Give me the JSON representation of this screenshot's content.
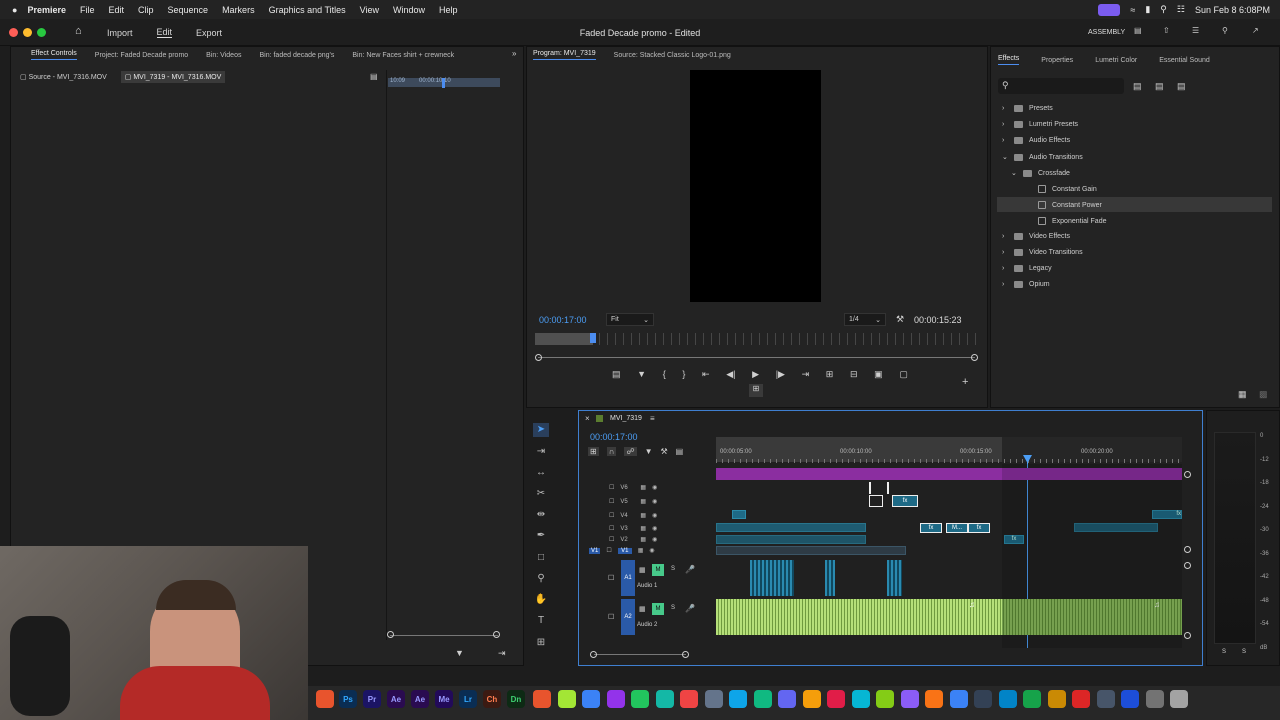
{
  "menubar": {
    "app": "Premiere",
    "items": [
      "File",
      "Edit",
      "Clip",
      "Sequence",
      "Markers",
      "Graphics and Titles",
      "View",
      "Window",
      "Help"
    ],
    "datetime": "Sun Feb 8  6:08PM"
  },
  "header": {
    "nav": [
      "Import",
      "Edit",
      "Export"
    ],
    "title": "Faded Decade promo - Edited",
    "workspace": "ASSEMBLY"
  },
  "left_panel": {
    "tabs": [
      "Effect Controls",
      "Project: Faded Decade promo",
      "Bin: Videos",
      "Bin: faded decade png's",
      "Bin: New Faces shirt + crewneck"
    ],
    "subtabs": [
      "Source - MVI_7316.MOV",
      "MVI_7319 - MVI_7316.MOV"
    ],
    "ruler_start": "10:09",
    "ruler_mid": "00:00:10:10"
  },
  "program": {
    "tabs": [
      "Program: MVI_7319",
      "Source: Stacked Classic Logo-01.png"
    ],
    "current_time": "00:00:17:00",
    "fit": "Fit",
    "resolution": "1/4",
    "duration": "00:00:15:23"
  },
  "effects": {
    "tabs": [
      "Effects",
      "Properties",
      "Lumetri Color",
      "Essential Sound"
    ],
    "tree": [
      {
        "label": "Presets",
        "level": 0,
        "type": "folder",
        "open": false
      },
      {
        "label": "Lumetri Presets",
        "level": 0,
        "type": "folder",
        "open": false
      },
      {
        "label": "Audio Effects",
        "level": 0,
        "type": "folder",
        "open": false
      },
      {
        "label": "Audio Transitions",
        "level": 0,
        "type": "folder",
        "open": true
      },
      {
        "label": "Crossfade",
        "level": 1,
        "type": "folder",
        "open": true
      },
      {
        "label": "Constant Gain",
        "level": 2,
        "type": "effect"
      },
      {
        "label": "Constant Power",
        "level": 2,
        "type": "effect",
        "selected": true
      },
      {
        "label": "Exponential Fade",
        "level": 2,
        "type": "effect"
      },
      {
        "label": "Video Effects",
        "level": 0,
        "type": "folder",
        "open": false
      },
      {
        "label": "Video Transitions",
        "level": 0,
        "type": "folder",
        "open": false
      },
      {
        "label": "Legacy",
        "level": 0,
        "type": "folder",
        "open": false
      },
      {
        "label": "Opium",
        "level": 0,
        "type": "folder",
        "open": false
      }
    ]
  },
  "timeline": {
    "sequence": "MVI_7319",
    "current_time": "00:00:17:00",
    "ruler": [
      "00:00:05:00",
      "00:00:10:00",
      "00:00:15:00",
      "00:00:20:00"
    ],
    "video_tracks": [
      "V6",
      "V5",
      "V4",
      "V3",
      "V2",
      "V1"
    ],
    "source_patch": "V1",
    "audio_tracks": [
      {
        "id": "A1",
        "name": "Audio 1",
        "m": "M",
        "s": "S"
      },
      {
        "id": "A2",
        "name": "Audio 2",
        "m": "M",
        "s": "S"
      }
    ],
    "clip_label": "fx",
    "clip_label_m": "M..."
  },
  "meter": {
    "scale": [
      "0",
      "-12",
      "-18",
      "-24",
      "-30",
      "-36",
      "-42",
      "-48",
      "-54",
      "dB"
    ],
    "solo": [
      "S",
      "S"
    ]
  },
  "dock": [
    "Ps",
    "Pr",
    "Ae",
    "Ae",
    "Me",
    "Lr",
    "Ch",
    "Dn"
  ]
}
